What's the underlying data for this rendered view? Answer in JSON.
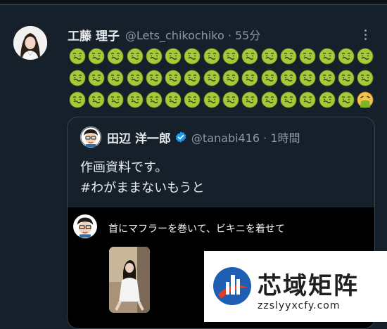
{
  "tweet": {
    "display_name": "工藤 理子",
    "handle_line": "@Lets_chikochiko · 55分",
    "emoji_rows": [
      {
        "icons": [
          "nauseated-face",
          "nauseated-face",
          "nauseated-face",
          "nauseated-face",
          "nauseated-face",
          "nauseated-face",
          "nauseated-face",
          "nauseated-face",
          "nauseated-face",
          "nauseated-face",
          "nauseated-face",
          "nauseated-face",
          "nauseated-face",
          "nauseated-face",
          "nauseated-face",
          "nauseated-face"
        ]
      },
      {
        "icons": [
          "nauseated-face",
          "nauseated-face",
          "nauseated-face",
          "nauseated-face",
          "nauseated-face",
          "nauseated-face",
          "nauseated-face",
          "nauseated-face",
          "nauseated-face",
          "nauseated-face",
          "nauseated-face",
          "nauseated-face",
          "nauseated-face",
          "nauseated-face",
          "nauseated-face",
          "nauseated-face"
        ]
      },
      {
        "icons": [
          "nauseated-face",
          "nauseated-face",
          "nauseated-face",
          "nauseated-face",
          "nauseated-face",
          "nauseated-face",
          "nauseated-face",
          "nauseated-face",
          "nauseated-face",
          "nauseated-face",
          "nauseated-face",
          "nauseated-face",
          "nauseated-face",
          "nauseated-face",
          "nauseated-face",
          "vomiting-face"
        ]
      }
    ]
  },
  "quote": {
    "display_name": "田辺 洋一郎",
    "handle_line": "@tanabi416 · 1時間",
    "text_line1": "作画資料です。",
    "text_line2": "#わがままないもうと",
    "media_caption": "首にマフラーを巻いて、ビキニを着せて"
  },
  "watermark": {
    "title": "芯域矩阵",
    "url": "zzslyyxcfy.com"
  },
  "colors": {
    "background": "#15202b",
    "text_primary": "#e7e9ea",
    "text_secondary": "#8b98a5",
    "border": "#38444d",
    "verified": "#1d9bf0",
    "nausea_green": "#a6c93a"
  }
}
